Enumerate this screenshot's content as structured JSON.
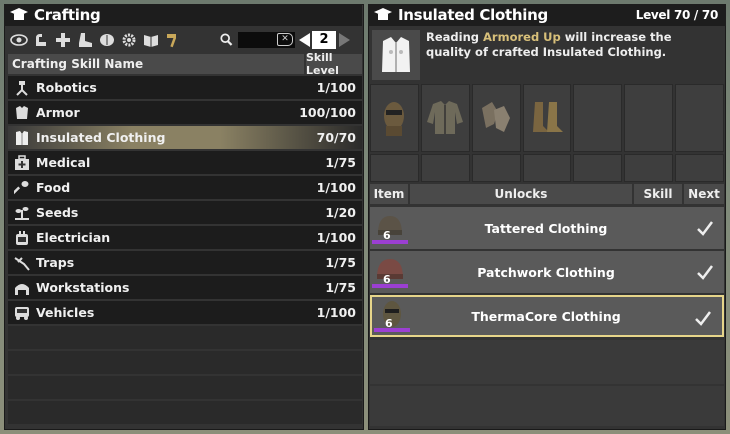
{
  "left_panel": {
    "title": "Crafting",
    "toolbar": {
      "icons": [
        "eye-icon",
        "arm-icon",
        "plus-icon",
        "boot-icon",
        "brain-icon",
        "gear-icon",
        "book-icon",
        "hammer-icon"
      ],
      "page_number": "2"
    },
    "columns": {
      "name": "Crafting Skill Name",
      "level": "Skill Level"
    },
    "skills": [
      {
        "icon": "robot-icon",
        "name": "Robotics",
        "level": "1/100"
      },
      {
        "icon": "armor-icon",
        "name": "Armor",
        "level": "100/100"
      },
      {
        "icon": "vest-icon",
        "name": "Insulated Clothing",
        "level": "70/70",
        "selected": true
      },
      {
        "icon": "medkit-icon",
        "name": "Medical",
        "level": "1/75"
      },
      {
        "icon": "spoon-icon",
        "name": "Food",
        "level": "1/100"
      },
      {
        "icon": "sprout-icon",
        "name": "Seeds",
        "level": "1/20"
      },
      {
        "icon": "electric-icon",
        "name": "Electrician",
        "level": "1/100"
      },
      {
        "icon": "trap-icon",
        "name": "Traps",
        "level": "1/75"
      },
      {
        "icon": "workbench-icon",
        "name": "Workstations",
        "level": "1/75"
      },
      {
        "icon": "vehicle-icon",
        "name": "Vehicles",
        "level": "1/100"
      }
    ]
  },
  "right_panel": {
    "title": "Insulated Clothing",
    "level": "Level 70 / 70",
    "info": {
      "prefix": "Reading ",
      "book": "Armored Up",
      "suffix": " will increase the quality of crafted Insulated Clothing."
    },
    "item_icons": [
      "mask-icon",
      "jacket-icon",
      "gloves-icon",
      "boots-icon"
    ],
    "unlock_columns": {
      "item": "Item",
      "unlocks": "Unlocks",
      "skill": "Skill",
      "next": "Next"
    },
    "unlocks": [
      {
        "name": "Tattered Clothing",
        "quality": "6",
        "icon": "beanie-icon"
      },
      {
        "name": "Patchwork Clothing",
        "quality": "6",
        "icon": "hat-icon"
      },
      {
        "name": "ThermaCore Clothing",
        "quality": "6",
        "icon": "balaclava-icon",
        "selected": true
      }
    ]
  }
}
